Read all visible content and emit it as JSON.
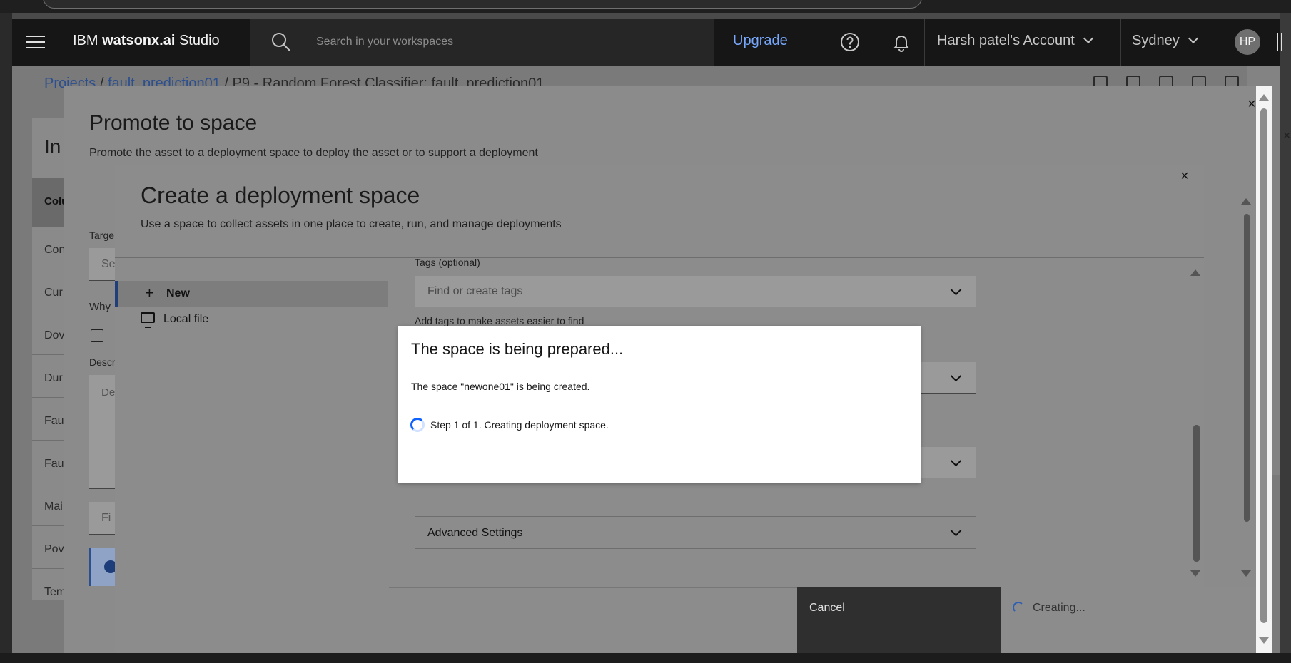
{
  "app": {
    "brand_prefix": "IBM ",
    "brand_bold": "watsonx.ai",
    "brand_suffix": " Studio",
    "search_placeholder": "Search in your workspaces",
    "upgrade_label": "Upgrade",
    "account_label": "Harsh patel's Account",
    "region_label": "Sydney",
    "avatar_initials": "HP"
  },
  "breadcrumb": {
    "projects": "Projects",
    "project_name": "fault_prediction01",
    "asset": "P9 - Random Forest Classifier: fault_prediction01"
  },
  "background_page": {
    "title_fragment": "In",
    "column_header_fragment": "Colu",
    "row_fragments": [
      "Con",
      "Cur",
      "Dov",
      "Dur",
      "Fau",
      "Fau",
      "Mai",
      "Pov",
      "Tem"
    ]
  },
  "promote_modal": {
    "title": "Promote to space",
    "subtitle": "Promote the asset to a deployment space to deploy the asset or to support a deployment",
    "target_label_fragment": "Targe",
    "target_input_fragment": "Se",
    "why_label_fragment": "Why",
    "description_label_fragment": "Descr",
    "description_placeholder_fragment": "De",
    "find_placeholder_fragment": "Fi",
    "close_symbol": "×"
  },
  "create_modal": {
    "title": "Create a deployment space",
    "subtitle": "Use a space to collect assets in one place to create, run, and manage deployments",
    "close_symbol": "×",
    "nav": {
      "new_label": "New",
      "local_file_label": "Local file"
    },
    "tags": {
      "label": "Tags (optional)",
      "placeholder": "Find or create tags",
      "helper": "Add tags to make assets easier to find"
    },
    "advanced_settings_label": "Advanced Settings",
    "cancel_label": "Cancel",
    "creating_label": "Creating..."
  },
  "progress_dialog": {
    "title": "The space is being prepared...",
    "message": "The space \"newone01\" is being created.",
    "step": "Step 1 of 1. Creating deployment space."
  },
  "colors": {
    "header_bg": "#161616",
    "upgrade_link": "#78a9ff",
    "spinner_blue": "#0f62fe",
    "dialog_bg": "#ffffff"
  },
  "icons": [
    "menu-icon",
    "search-icon",
    "help-icon",
    "bell-icon",
    "chevron-down-icon",
    "close-icon",
    "plus-icon",
    "monitor-icon",
    "spinner-icon"
  ]
}
